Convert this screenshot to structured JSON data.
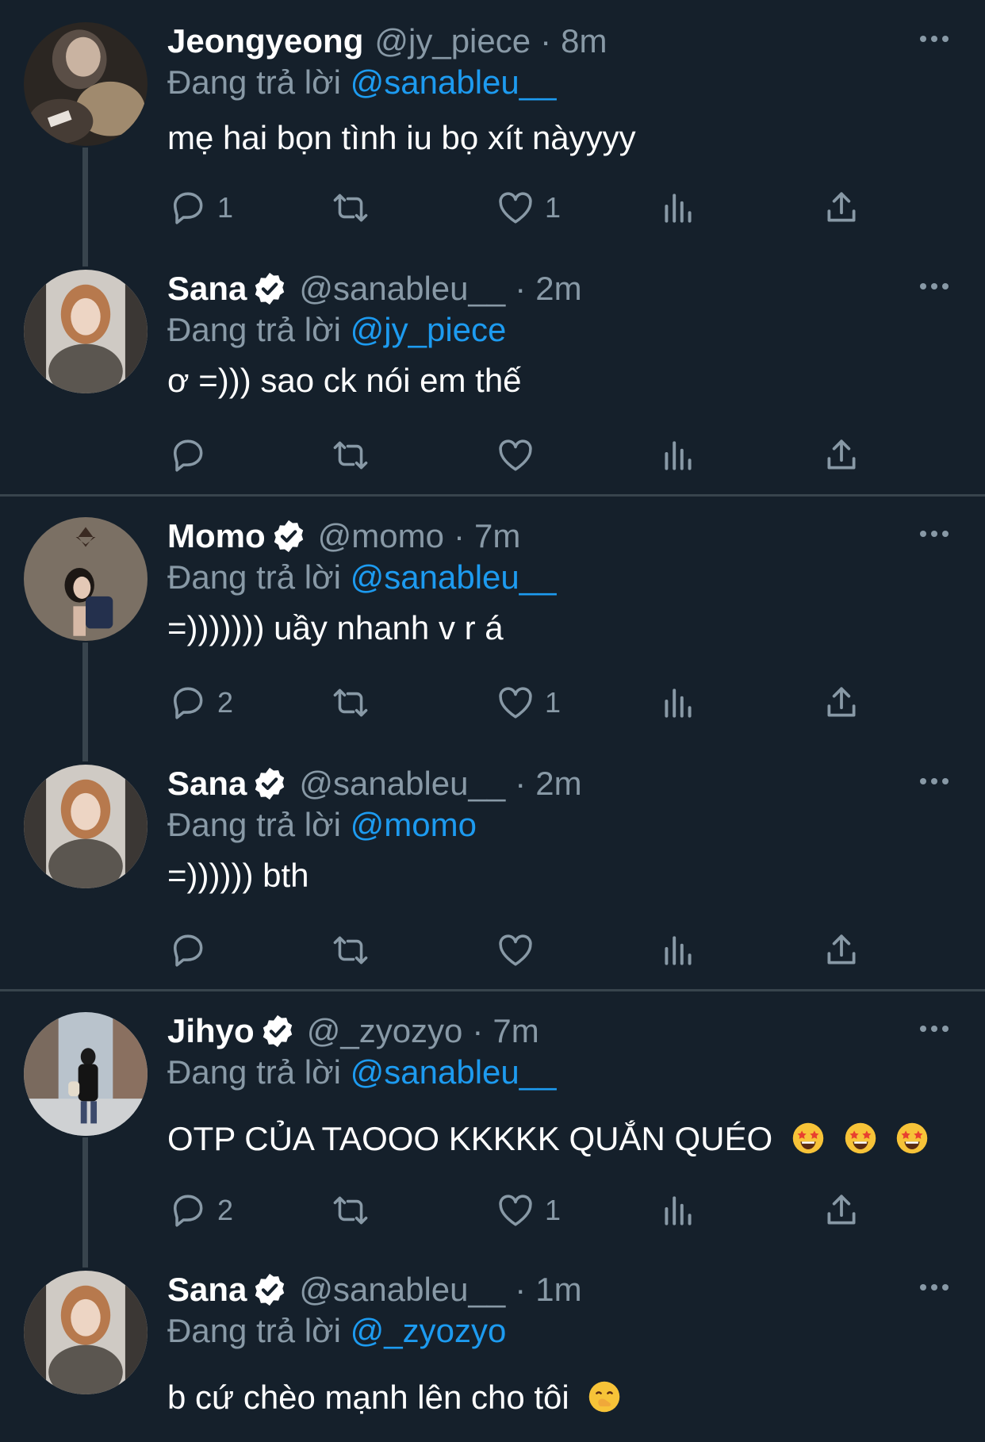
{
  "replying_prefix": "Đang trả lời",
  "tweets": [
    {
      "name": "Jeongyeong",
      "handle": "@jy_piece",
      "dot": "·",
      "time": "8m",
      "reply_to": "@sanableu__",
      "text": "mẹ hai bọn tình iu bọ xít nàyyyy",
      "replies": "1",
      "retweets": "",
      "likes": "1"
    },
    {
      "name": "Sana",
      "handle": "@sanableu__",
      "dot": "·",
      "time": "2m",
      "reply_to": "@jy_piece",
      "text": "ơ =))) sao ck nói em thế",
      "replies": "",
      "retweets": "",
      "likes": ""
    },
    {
      "name": "Momo",
      "handle": "@momo",
      "dot": "·",
      "time": "7m",
      "reply_to": "@sanableu__",
      "text": "=))))))) uầy nhanh v r á",
      "replies": "2",
      "retweets": "",
      "likes": "1"
    },
    {
      "name": "Sana",
      "handle": "@sanableu__",
      "dot": "·",
      "time": "2m",
      "reply_to": "@momo",
      "text": "=)))))) bth",
      "replies": "",
      "retweets": "",
      "likes": ""
    },
    {
      "name": "Jihyo",
      "handle": "@_zyozyo",
      "dot": "·",
      "time": "7m",
      "reply_to": "@sanableu__",
      "text": "OTP CỦA TAOOO KKKKK QUẮN QUÉO",
      "replies": "2",
      "retweets": "",
      "likes": "1"
    },
    {
      "name": "Sana",
      "handle": "@sanableu__",
      "dot": "·",
      "time": "1m",
      "reply_to": "@_zyozyo",
      "text": "b cứ chèo mạnh lên cho tôi",
      "replies": "",
      "retweets": "",
      "likes": ""
    }
  ],
  "colors": {
    "background": "#15202b",
    "text": "#ffffff",
    "muted": "#8899a6",
    "link": "#1d9bf0",
    "divider": "#38444d",
    "verified_badge": "#ffffff"
  },
  "icons": {
    "reply": "reply-icon",
    "retweet": "retweet-icon",
    "like": "heart-icon",
    "views": "bar-chart-icon",
    "share": "share-icon",
    "more": "more-dots-icon",
    "verified": "verified-badge-icon",
    "emoji_star_struck": "star-struck-emoji",
    "emoji_hand_over_mouth": "hand-over-mouth-emoji"
  }
}
